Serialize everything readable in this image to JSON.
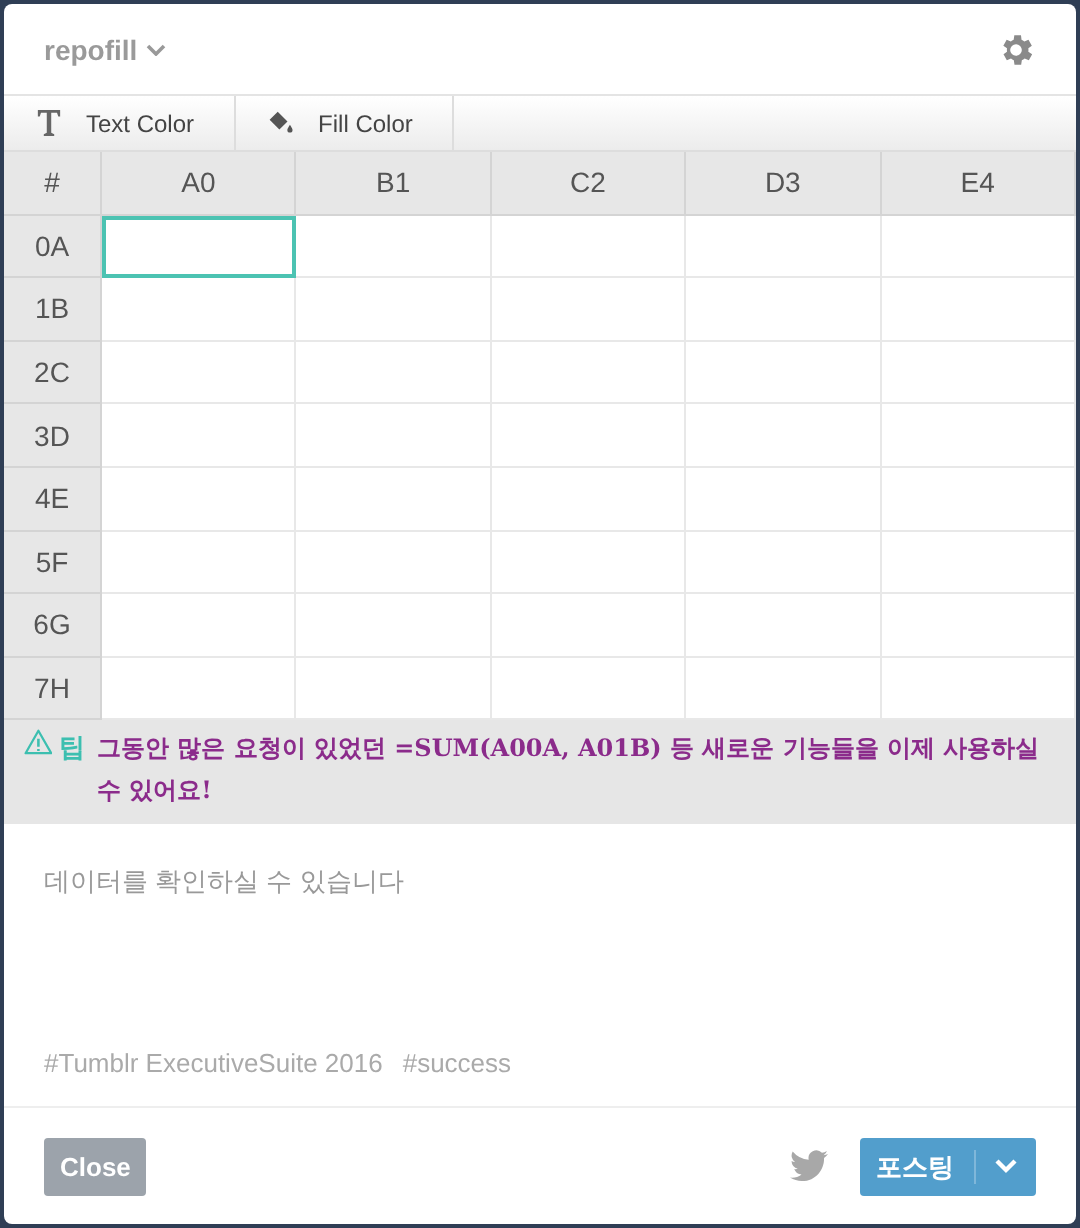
{
  "header": {
    "blog": "repofill"
  },
  "toolbar": [
    {
      "kind": "text",
      "label": "Text Color"
    },
    {
      "kind": "fill",
      "label": "Fill Color"
    }
  ],
  "table": {
    "corner": "#",
    "columns": [
      "A0",
      "B1",
      "C2",
      "D3",
      "E4"
    ],
    "rows": [
      {
        "label": "0A",
        "cells": [
          {
            "selected": true
          },
          {
            "selected": false
          },
          {
            "selected": false
          },
          {
            "selected": false
          },
          {
            "selected": false
          }
        ]
      },
      {
        "label": "1B",
        "cells": [
          {
            "selected": false
          },
          {
            "selected": false
          },
          {
            "selected": false
          },
          {
            "selected": false
          },
          {
            "selected": false
          }
        ]
      },
      {
        "label": "2C",
        "cells": [
          {
            "selected": false
          },
          {
            "selected": false
          },
          {
            "selected": false
          },
          {
            "selected": false
          },
          {
            "selected": false
          }
        ]
      },
      {
        "label": "3D",
        "cells": [
          {
            "selected": false
          },
          {
            "selected": false
          },
          {
            "selected": false
          },
          {
            "selected": false
          },
          {
            "selected": false
          }
        ]
      },
      {
        "label": "4E",
        "cells": [
          {
            "selected": false
          },
          {
            "selected": false
          },
          {
            "selected": false
          },
          {
            "selected": false
          },
          {
            "selected": false
          }
        ]
      },
      {
        "label": "5F",
        "cells": [
          {
            "selected": false
          },
          {
            "selected": false
          },
          {
            "selected": false
          },
          {
            "selected": false
          },
          {
            "selected": false
          }
        ]
      },
      {
        "label": "6G",
        "cells": [
          {
            "selected": false
          },
          {
            "selected": false
          },
          {
            "selected": false
          },
          {
            "selected": false
          },
          {
            "selected": false
          }
        ]
      },
      {
        "label": "7H",
        "cells": [
          {
            "selected": false
          },
          {
            "selected": false
          },
          {
            "selected": false
          },
          {
            "selected": false
          },
          {
            "selected": false
          }
        ]
      }
    ]
  },
  "tip": {
    "label": "팁",
    "message": "그동안 많은 요청이 있었던 =SUM(A00A, A01B) 등 새로운 기능들을 이제 사용하실 수 있어요!"
  },
  "body": {
    "placeholder": "데이터를 확인하실 수 있습니다"
  },
  "tags": [
    "#Tumblr ExecutiveSuite 2016",
    "#success"
  ],
  "footer": {
    "close": "Close",
    "post": "포스팅"
  }
}
